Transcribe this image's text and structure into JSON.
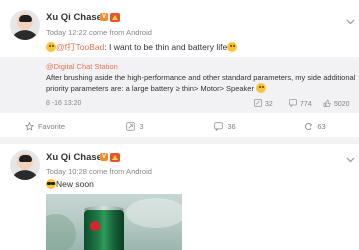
{
  "posts": [
    {
      "username": "Xu Qi Chase",
      "badge_v": "V",
      "time": "Today 12:22",
      "source": "come from Android",
      "mention": "@f打TooBad",
      "text": ": I want to be thin and battery life",
      "repost": {
        "author": "@Digital Chat Station",
        "text": "After brushing aside the high-performance and other standard parameters, my side additional priority parameters are: a large battery ≥ thin> Motor> Speaker",
        "date": "8 -16 13:20",
        "likes": "32",
        "comments": "774",
        "reposts": "5020"
      },
      "actions": {
        "favorite": "Favorite",
        "repost_count": "3",
        "comment_count": "36",
        "like_count": "63"
      }
    },
    {
      "username": "Xu Qi Chase",
      "badge_v": "V",
      "time": "Today 10:28",
      "source": "come from Android",
      "text": "New soon"
    }
  ],
  "icons": {
    "favorite": "star-icon",
    "repost": "repost-icon",
    "comment": "comment-icon",
    "like": "like-icon",
    "dropdown": "chevron-down-icon"
  },
  "colors": {
    "accent": "#eb7350",
    "vip_badge": "#f38b2b",
    "level_badge": "#e8542e",
    "repost_bg": "#f2f2f5"
  }
}
